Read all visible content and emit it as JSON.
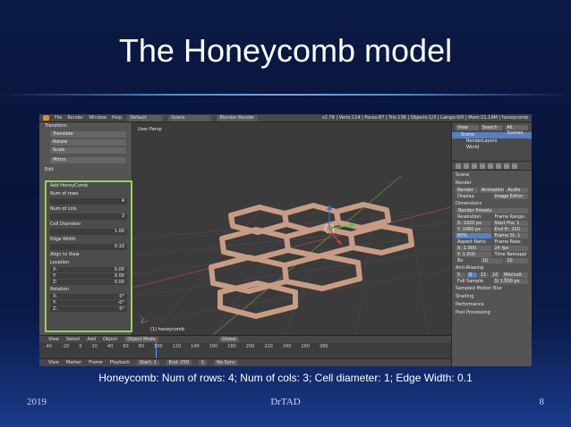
{
  "slide": {
    "title": "The Honeycomb model",
    "caption": "Honeycomb: Num of rows: 4; Num of cols: 3; Cell diameter: 1; Edge Width: 0.1",
    "footer_left": "2019",
    "footer_center": "DrTAD",
    "footer_right": "8"
  },
  "blender": {
    "menu": [
      "File",
      "Render",
      "Window",
      "Help"
    ],
    "layout": "Default",
    "scene": "Scene",
    "engine": "Blender Render",
    "stats": "v2.79 | Verts:114 | Faces:87 | Tris:136 | Objects:1/3 | Lamps:0/0 | Mem:11.14M | honeycomb",
    "tools": {
      "header": "Transform",
      "buttons": [
        "Translate",
        "Rotate",
        "Scale",
        "Mirror"
      ],
      "edit_header": "Edit"
    },
    "operator": {
      "title": "Add HoneyComb",
      "rows_label": "Num of rows",
      "rows_value": "4",
      "cols_label": "Num of cols",
      "cols_value": "3",
      "diameter_label": "Cell Diameter",
      "diameter_value": "1.00",
      "edge_label": "Edge Width",
      "edge_value": "0.10",
      "align_label": "Align to View",
      "location_label": "Location",
      "location": [
        {
          "axis": "X:",
          "value": "0.00"
        },
        {
          "axis": "Y:",
          "value": "0.00"
        },
        {
          "axis": "Z:",
          "value": "0.00"
        }
      ],
      "rotation_label": "Rotation",
      "rotation": [
        {
          "axis": "X:",
          "value": "0°"
        },
        {
          "axis": "Y:",
          "value": "-0°"
        },
        {
          "axis": "Z:",
          "value": "0°"
        }
      ]
    },
    "viewport": {
      "label": "User Persp",
      "object": "(1) honeycomb"
    },
    "view_header": {
      "items": [
        "View",
        "Select",
        "Add",
        "Object"
      ],
      "mode": "Object Mode",
      "orientation": "Global"
    },
    "timeline": {
      "ticks": [
        "-40",
        "-20",
        "0",
        "20",
        "40",
        "60",
        "80",
        "100",
        "120",
        "140",
        "160",
        "180",
        "200",
        "220",
        "240",
        "260",
        "280"
      ],
      "items": [
        "View",
        "Marker",
        "Frame",
        "Playback"
      ],
      "start_label": "Start:",
      "start": "1",
      "end_label": "End:",
      "end": "250",
      "current": "1",
      "sync": "No Sync"
    },
    "outliner": {
      "tabs": [
        "View",
        "Search",
        "All Scenes"
      ],
      "items": [
        "Scene",
        "RenderLayers",
        "World"
      ]
    },
    "properties": {
      "scene": "Scene",
      "render_header": "Render",
      "render_buttons": [
        "Render",
        "Animation",
        "Audio"
      ],
      "display_label": "Display:",
      "display_value": "Image Editor",
      "dimensions_header": "Dimensions",
      "presets": "Render Presets",
      "resolution_label": "Resolution:",
      "frame_range_label": "Frame Range:",
      "res_x": "X: 1920 px",
      "res_y": "Y: 1080 px",
      "res_pct": "50%",
      "start_frame": "Start Fra: 1",
      "end_frame": "End Fr: 250",
      "frame_step": "Frame St: 1",
      "aspect_label": "Aspect Ratio:",
      "frame_rate_label": "Frame Rate:",
      "aspect_x": "X: 1.000",
      "aspect_y": "Y: 1.000",
      "fps": "24 fps",
      "time_remap_label": "Time Remappi",
      "bo": "Bo",
      "remap_old": "10",
      "remap_new": "10",
      "aa_header": "Anti-Aliasing",
      "aa_values": [
        "5",
        "8",
        "11",
        "16"
      ],
      "aa_filter": "Mitchell-Net",
      "full_sample": "Full Sample",
      "aa_size": "Si 1.000 px",
      "panels": [
        "Sampled Motion Blur",
        "Shading",
        "Performance",
        "Post Processing"
      ]
    }
  }
}
